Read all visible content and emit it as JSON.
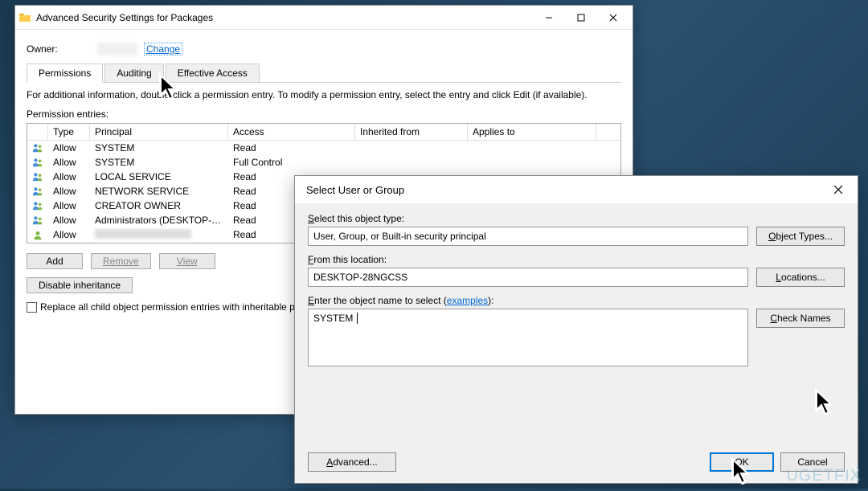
{
  "window1": {
    "title": "Advanced Security Settings for Packages",
    "owner_label": "Owner:",
    "change_link": "Change",
    "tabs": [
      "Permissions",
      "Auditing",
      "Effective Access"
    ],
    "instructions": "For additional information, double-click a permission entry. To modify a permission entry, select the entry and click Edit (if available).",
    "entries_label": "Permission entries:",
    "columns": {
      "type": "Type",
      "principal": "Principal",
      "access": "Access",
      "inherited": "Inherited from",
      "applies": "Applies to"
    },
    "rows": [
      {
        "type": "Allow",
        "principal": "SYSTEM",
        "access": "Read"
      },
      {
        "type": "Allow",
        "principal": "SYSTEM",
        "access": "Full Control"
      },
      {
        "type": "Allow",
        "principal": "LOCAL SERVICE",
        "access": "Read"
      },
      {
        "type": "Allow",
        "principal": "NETWORK SERVICE",
        "access": "Read"
      },
      {
        "type": "Allow",
        "principal": "CREATOR OWNER",
        "access": "Read"
      },
      {
        "type": "Allow",
        "principal": "Administrators (DESKTOP-28...",
        "access": "Read"
      },
      {
        "type": "Allow",
        "principal": "",
        "access": "Read"
      }
    ],
    "buttons": {
      "add": "Add",
      "remove": "Remove",
      "view": "View",
      "disable": "Disable inheritance"
    },
    "checkbox_label": "Replace all child object permission entries with inheritable permission entries from this object"
  },
  "window2": {
    "title": "Select User or Group",
    "object_type_label": "Select this object type:",
    "object_type_value": "User, Group, or Built-in security principal",
    "object_types_btn": "Object Types...",
    "location_label": "From this location:",
    "location_value": "DESKTOP-28NGCSS",
    "locations_btn": "Locations...",
    "name_label_prefix": "Enter the object name to select (",
    "name_label_link": "examples",
    "name_label_suffix": "):",
    "name_value": "SYSTEM",
    "check_names_btn": "Check Names",
    "advanced_btn": "Advanced...",
    "ok_btn": "OK",
    "cancel_btn": "Cancel"
  },
  "watermark": "UGETFIX"
}
